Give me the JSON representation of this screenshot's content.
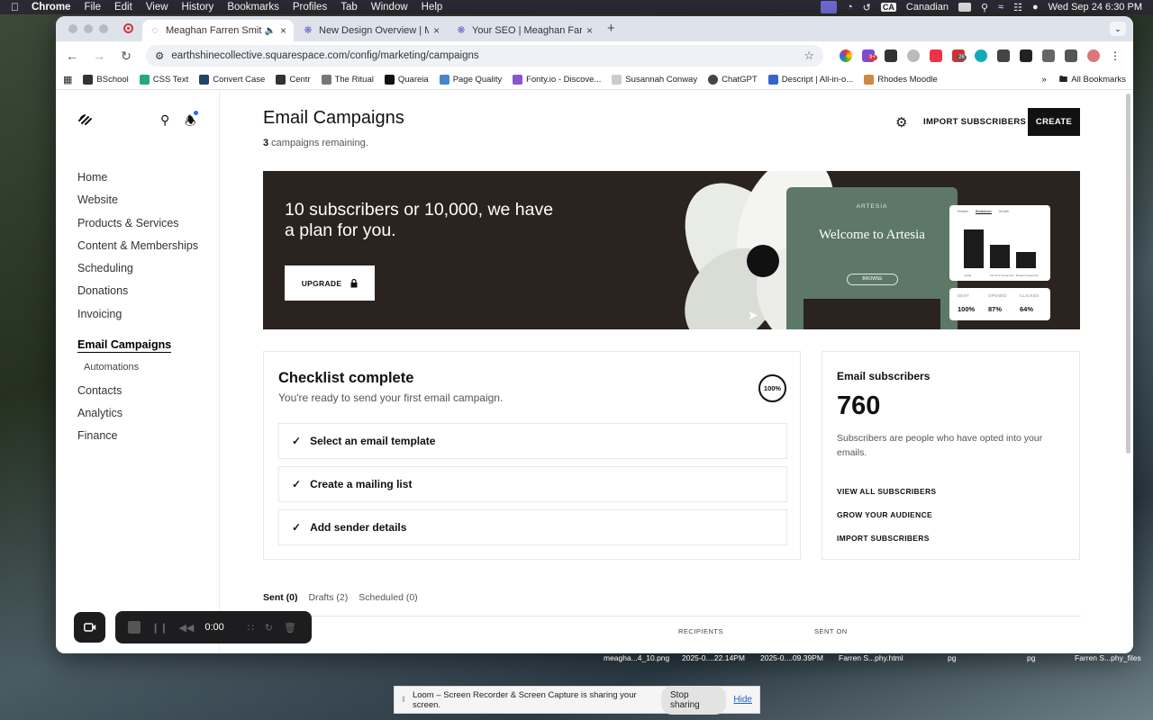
{
  "menubar": {
    "app": "Chrome",
    "items": [
      "File",
      "Edit",
      "View",
      "History",
      "Bookmarks",
      "Profiles",
      "Tab",
      "Window",
      "Help"
    ],
    "input_source": "Canadian",
    "input_flag": "CA",
    "clock": "Wed Sep 24  6:30 PM"
  },
  "browser": {
    "tabs": [
      {
        "title": "Meaghan Farren Smith Ph"
      },
      {
        "title": "New Design Overview | Meag"
      },
      {
        "title": "Your SEO | Meaghan Farren S"
      }
    ],
    "url": "earthshinecollective.squarespace.com/config/marketing/campaigns",
    "bookmarks": [
      "BSchool",
      "CSS Text",
      "Convert Case",
      "Centr",
      "The Ritual",
      "Quareia",
      "Page Quality",
      "Fonty.io - Discove...",
      "Susannah Conway",
      "ChatGPT",
      "Descript | All-in-o...",
      "Rhodes Moodle"
    ],
    "all_bookmarks": "All Bookmarks",
    "ext_badges": [
      "9+",
      "26"
    ]
  },
  "sidebar": {
    "items": [
      "Home",
      "Website",
      "Products & Services",
      "Content & Memberships",
      "Scheduling",
      "Donations",
      "Invoicing"
    ],
    "active": "Email Campaigns",
    "sub": "Automations",
    "more": [
      "Contacts",
      "Analytics",
      "Finance"
    ]
  },
  "main": {
    "title": "Email Campaigns",
    "remaining_count": "3",
    "remaining_text": " campaigns remaining.",
    "import_label": "IMPORT SUBSCRIBERS",
    "create_label": "CREATE"
  },
  "banner": {
    "headline": "10 subscribers or 10,000, we have a plan for you.",
    "upgrade_label": "UPGRADE",
    "mock_brand": "ARTESIA",
    "mock_welcome": "Welcome to Artesia",
    "mock_browse": "BROWSE",
    "mock_tabs": [
      "Timeline",
      "Breakdown",
      "Growth"
    ],
    "mock_bar_labels": [
      "Leads",
      "1st-Time Customers",
      "Repeat Customers"
    ],
    "mock_bars": [
      0.82,
      0.5,
      0.35
    ],
    "metrics": [
      {
        "label": "SENT",
        "value": "100%"
      },
      {
        "label": "OPENED",
        "value": "87%"
      },
      {
        "label": "CLICKED",
        "value": "64%"
      }
    ]
  },
  "checklist": {
    "title": "Checklist complete",
    "subtitle": "You're ready to send your first email campaign.",
    "progress": "100%",
    "items": [
      "Select an email template",
      "Create a mailing list",
      "Add sender details"
    ]
  },
  "subscribers": {
    "title": "Email subscribers",
    "count": "760",
    "description": "Subscribers are people who have opted into your emails.",
    "links": [
      "VIEW ALL SUBSCRIBERS",
      "GROW YOUR AUDIENCE",
      "IMPORT SUBSCRIBERS"
    ]
  },
  "campaign_tabs": [
    "Sent (0)",
    "Drafts (2)",
    "Scheduled (0)"
  ],
  "columns": [
    "RECIPIENTS",
    "SENT ON"
  ],
  "loom": {
    "timer": "0:00",
    "share_text": "Loom – Screen Recorder & Screen Capture is sharing your screen.",
    "stop_label": "Stop sharing",
    "hide_label": "Hide"
  },
  "desktop_files": [
    "meagha...4_10.png",
    "2025-0....22.14PM",
    "2025-0....09.39PM",
    "Farren S...phy.html",
    "pg",
    "pg",
    "Farren S...phy_files"
  ]
}
